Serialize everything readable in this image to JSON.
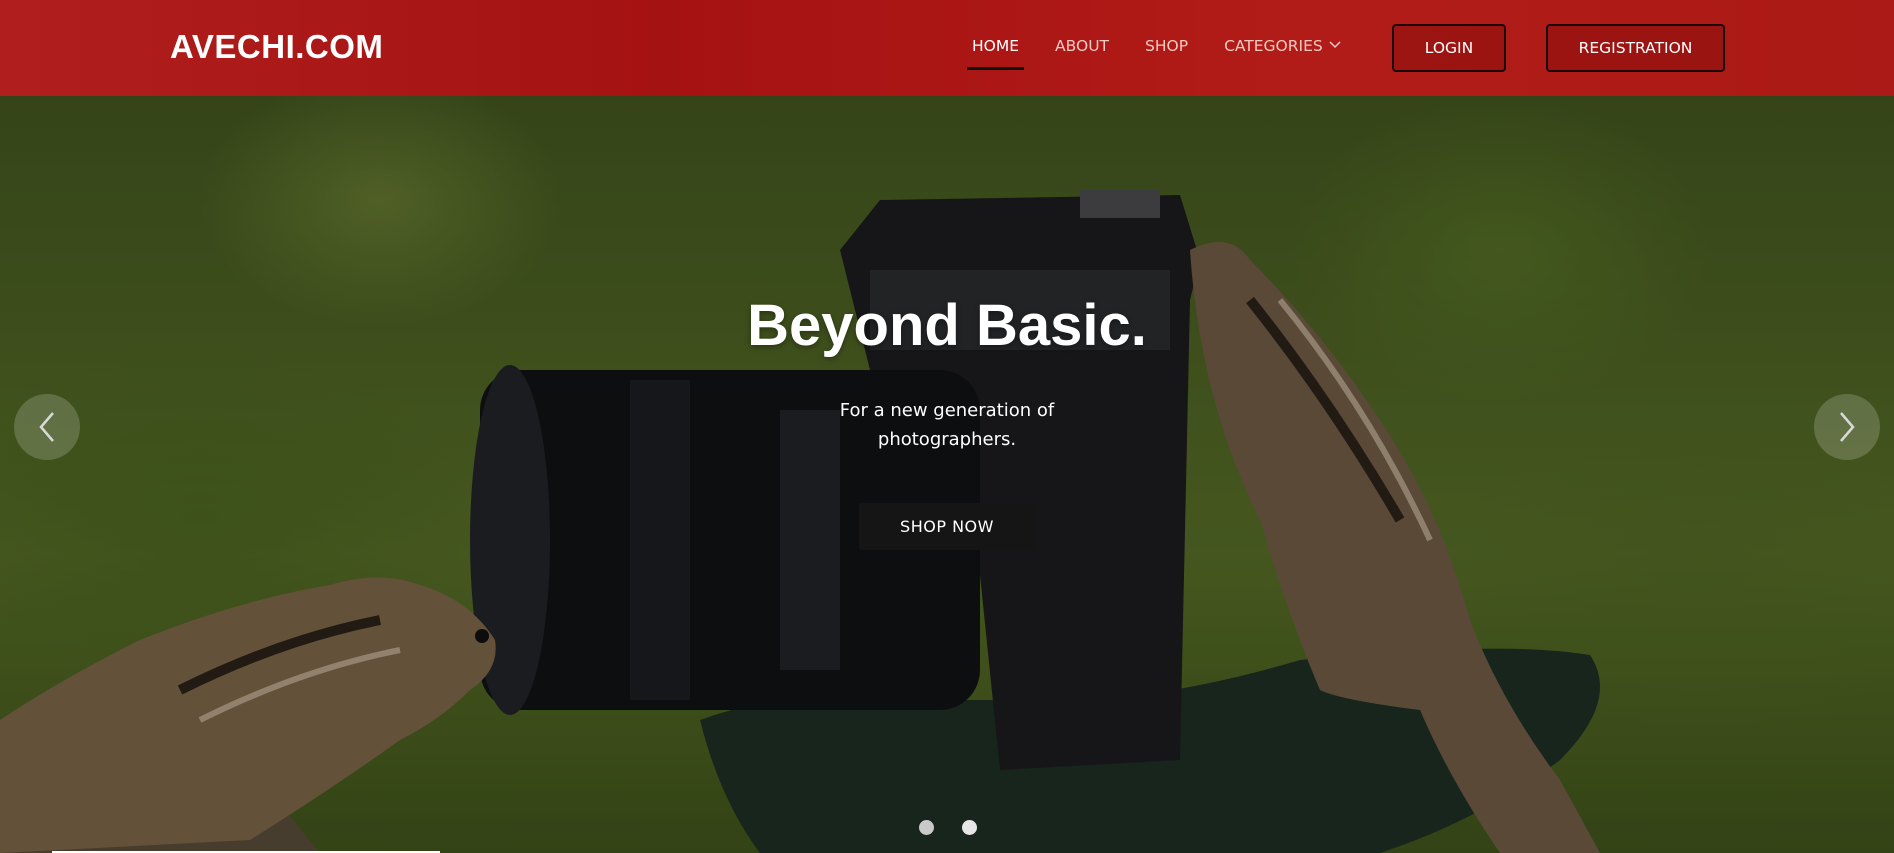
{
  "brand": {
    "name": "AVECHI.COM"
  },
  "nav": {
    "items": [
      {
        "label": "HOME",
        "active": true
      },
      {
        "label": "ABOUT",
        "active": false
      },
      {
        "label": "SHOP",
        "active": false
      },
      {
        "label": "CATEGORIES",
        "active": false,
        "dropdown": true
      }
    ],
    "login_label": "LOGIN",
    "register_label": "REGISTRATION"
  },
  "hero": {
    "title": "Beyond Basic.",
    "subtitle": "For a new generation of photographers.",
    "cta_label": "SHOP NOW",
    "slide_count": 2,
    "active_slide": 2
  },
  "icons": {
    "prev": "chevron-left-icon",
    "next": "chevron-right-icon",
    "dropdown": "chevron-down-icon"
  },
  "colors": {
    "navbar": "#a51212",
    "cta_background": "#151515",
    "text": "#ffffff"
  }
}
